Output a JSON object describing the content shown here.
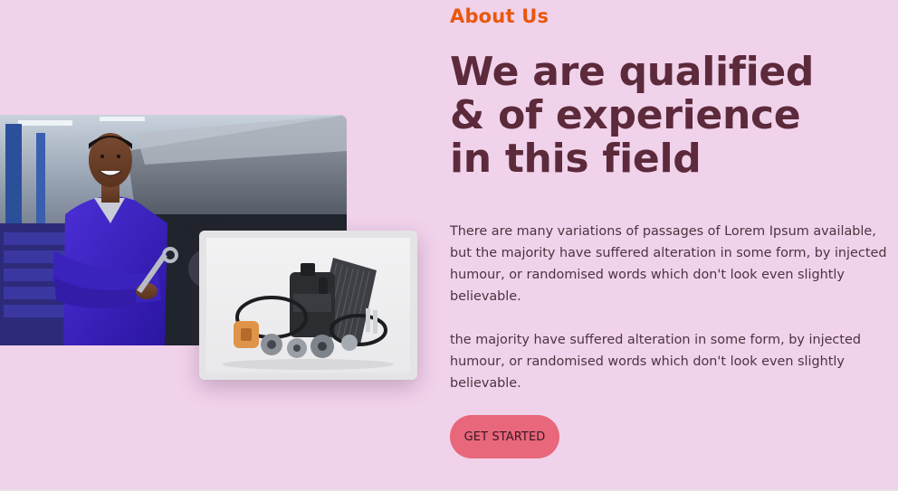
{
  "about": {
    "eyebrow": "About Us",
    "headline_lines": [
      "We are qualified",
      "& of experience",
      "in this field"
    ],
    "paragraphs": [
      "There are many variations of passages of Lorem Ipsum available, but the majority have suffered alteration in some form, by injected humour, or randomised words which don't look even slightly believable.",
      "the majority have suffered alteration in some form, by injected humour, or randomised words which don't look even slightly believable."
    ],
    "cta_label": "GET STARTED"
  },
  "images": {
    "main": "mechanic-photo",
    "secondary": "auto-parts-photo"
  },
  "colors": {
    "background": "#f1d2eb",
    "eyebrow": "#e8570c",
    "headline": "#5c2a3a",
    "body_text": "#4b3440",
    "cta_background": "#e8677a"
  }
}
